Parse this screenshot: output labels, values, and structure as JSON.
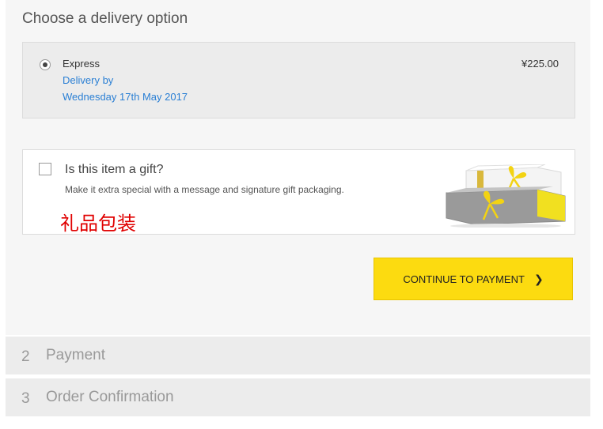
{
  "delivery": {
    "title": "Choose a delivery option",
    "option": {
      "name": "Express",
      "delivery_by": "Delivery by",
      "date": "Wednesday 17th May 2017",
      "price": "¥225.00",
      "selected": true
    }
  },
  "gift": {
    "question": "Is this item a gift?",
    "description": "Make it extra special with a message and signature gift packaging.",
    "chinese_note": "礼品包装",
    "checked": false,
    "image_icon": "gift-box-icon"
  },
  "actions": {
    "continue_label": "CONTINUE TO PAYMENT",
    "continue_icon": "chevron-right-icon",
    "continue_color": "#fcdb10"
  },
  "steps": [
    {
      "number": "2",
      "label": "Payment"
    },
    {
      "number": "3",
      "label": "Order Confirmation"
    }
  ]
}
